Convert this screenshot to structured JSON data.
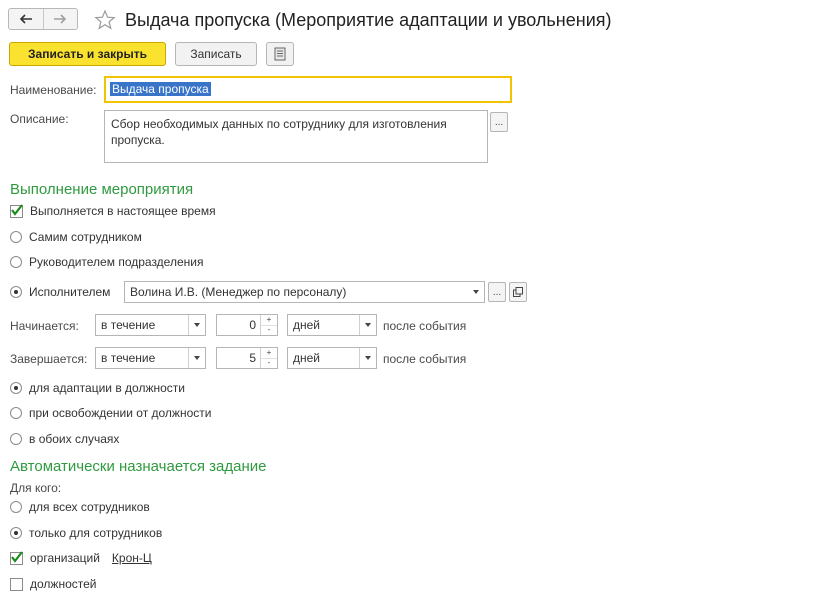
{
  "window": {
    "title": "Выдача пропуска (Мероприятие адаптации и увольнения)"
  },
  "toolbar": {
    "save_close_label": "Записать и закрыть",
    "save_label": "Записать"
  },
  "form": {
    "name_label": "Наименование:",
    "name_value": "Выдача пропуска",
    "description_label": "Описание:",
    "description_value": "Сбор необходимых данных по сотруднику  для изготовления пропуска.",
    "more_button": "..."
  },
  "execution": {
    "section_title": "Выполнение мероприятия",
    "currently_performed_label": "Выполняется в настоящее время",
    "currently_performed_checked": true,
    "executor_options": [
      {
        "label": "Самим сотрудником",
        "selected": false
      },
      {
        "label": "Руководителем подразделения",
        "selected": false
      },
      {
        "label": "Исполнителем",
        "selected": true
      }
    ],
    "executor_value": "Волина И.В. (Менеджер по персоналу)",
    "starts": {
      "label": "Начинается:",
      "mode": "в течение",
      "amount": "0",
      "unit": "дней",
      "suffix": "после события"
    },
    "ends": {
      "label": "Завершается:",
      "mode": "в течение",
      "amount": "5",
      "unit": "дней",
      "suffix": "после события"
    },
    "case_options": [
      {
        "label": "для адаптации в должности",
        "selected": true
      },
      {
        "label": "при освобождении от должности",
        "selected": false
      },
      {
        "label": "в обоих случаях",
        "selected": false
      }
    ]
  },
  "assignment": {
    "section_title": "Автоматически назначается задание",
    "for_whom_label": "Для кого:",
    "whom_options": [
      {
        "label": "для всех сотрудников",
        "selected": false
      },
      {
        "label": "только для сотрудников",
        "selected": true
      }
    ],
    "org_label": "организаций",
    "org_checked": true,
    "org_value": "Крон-Ц",
    "positions_label": "должностей",
    "positions_checked": false
  },
  "colors": {
    "accent_yellow": "#fbe22f",
    "section_green": "#2f9a3f",
    "link_blue": "#1f5fc4",
    "selection_blue": "#3874c8"
  }
}
